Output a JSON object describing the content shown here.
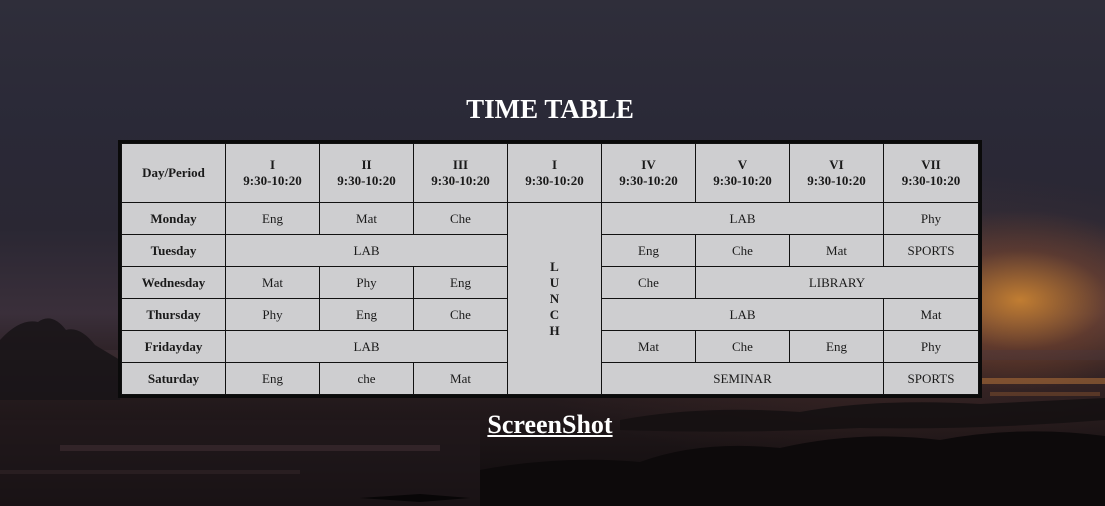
{
  "page": {
    "title": "TIME TABLE",
    "footer_link": "ScreenShot"
  },
  "timetable": {
    "header": {
      "day_period": "Day/Period",
      "periods": [
        {
          "num": "I",
          "time": "9:30-10:20"
        },
        {
          "num": "II",
          "time": "9:30-10:20"
        },
        {
          "num": "III",
          "time": "9:30-10:20"
        },
        {
          "num": "I",
          "time": "9:30-10:20"
        },
        {
          "num": "IV",
          "time": "9:30-10:20"
        },
        {
          "num": "V",
          "time": "9:30-10:20"
        },
        {
          "num": "VI",
          "time": "9:30-10:20"
        },
        {
          "num": "VII",
          "time": "9:30-10:20"
        }
      ]
    },
    "lunch_letters": [
      "L",
      "U",
      "N",
      "C",
      "H"
    ],
    "rows": [
      {
        "day": "Monday",
        "cells": [
          "Eng",
          "Mat",
          "Che",
          "LAB",
          "Phy"
        ]
      },
      {
        "day": "Tuesday",
        "cells": [
          "LAB",
          "Eng",
          "Che",
          "Mat",
          "SPORTS"
        ]
      },
      {
        "day": "Wednesday",
        "cells": [
          "Mat",
          "Phy",
          "Eng",
          "Che",
          "LIBRARY"
        ]
      },
      {
        "day": "Thursday",
        "cells": [
          "Phy",
          "Eng",
          "Che",
          "LAB",
          "Mat"
        ]
      },
      {
        "day": "Fridayday",
        "cells": [
          "LAB",
          "Mat",
          "Che",
          "Eng",
          "Phy"
        ]
      },
      {
        "day": "Saturday",
        "cells": [
          "Eng",
          "che",
          "Mat",
          "SEMINAR",
          "SPORTS"
        ]
      }
    ]
  },
  "colors": {
    "cell_bg": "#dedee0",
    "border": "#111111",
    "title_text": "#ffffff"
  }
}
